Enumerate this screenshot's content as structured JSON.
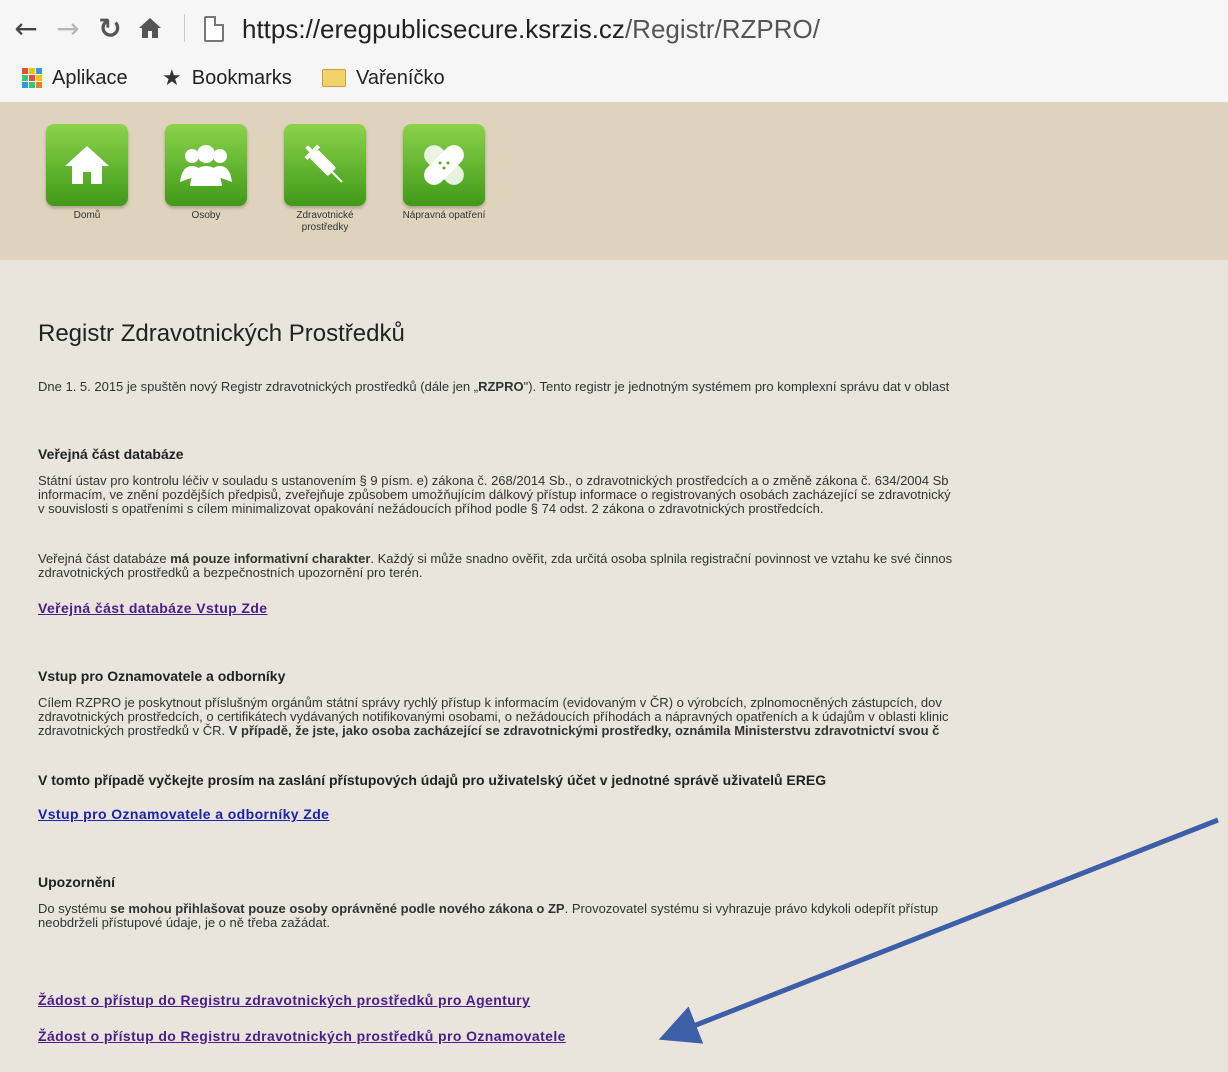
{
  "browser": {
    "url_host": "https://eregpublicsecure.ksrzis.cz",
    "url_path": "/Registr/RZPRO/",
    "bookmarks": [
      "Aplikace",
      "Bookmarks",
      "Vařeníčko"
    ]
  },
  "nav": {
    "tiles": [
      {
        "label": "Domů",
        "icon": "home-icon"
      },
      {
        "label": "Osoby",
        "icon": "people-icon"
      },
      {
        "label": "Zdravotnické prostředky",
        "icon": "syringe-icon"
      },
      {
        "label": "Nápravná opatření",
        "icon": "bandage-icon"
      }
    ]
  },
  "page": {
    "title": "Registr Zdravotnických Prostředků",
    "intro_1": "Dne 1. 5. 2015 je spuštěn nový Registr zdravotnických prostředků (dále jen „",
    "intro_bold": "RZPRO",
    "intro_2": "\"). Tento registr je jednotným systémem pro komplexní správu dat v oblast",
    "section1": {
      "heading": "Veřejná část databáze",
      "p1_line1": "Státní ústav pro kontrolu léčiv v souladu s ustanovením § 9 písm. e) zákona č. 268/2014 Sb., o zdravotnických prostředcích a o změně zákona č. 634/2004 Sb",
      "p1_line2": "informacím, ve znění pozdějších předpisů, zveřejňuje způsobem umožňujícím dálkový přístup informace o registrovaných osobách zacházející se zdravotnický",
      "p1_line3": "v souvislosti s opatřeními s cílem minimalizovat opakování nežádoucích příhod podle § 74 odst. 2 zákona o zdravotnických prostředcích.",
      "p2_a": "Veřejná část databáze ",
      "p2_bold": "má pouze informativní charakter",
      "p2_b": ". Každý si může snadno ověřit, zda určitá osoba splnila registrační povinnost ve vztahu ke své činnos",
      "p2_line2": "zdravotnických prostředků a bezpečnostních upozornění pro terén.",
      "link": "Veřejná část databáze Vstup Zde"
    },
    "section2": {
      "heading": "Vstup pro Oznamovatele a odborníky",
      "line1": "Cílem RZPRO je poskytnout příslušným orgánům státní správy rychlý přístup k informacím (evidovaným v ČR) o výrobcích, zplnomocněných zástupcích, dov",
      "line2": "zdravotnických prostředcích, o certifikátech vydávaných notifikovanými osobami, o nežádoucích příhodách a nápravných opatřeních a k údajům v oblasti klinic",
      "line3_a": "zdravotnických prostředků v ČR. ",
      "line3_bold": "V případě, že jste, jako osoba zacházející se zdravotnickými prostředky, oznámila Ministerstvu zdravotnictví svou č",
      "bold_line": "V tomto případě vyčkejte prosím na zaslání přístupových údajů pro uživatelský účet v jednotné správě uživatelů EREG",
      "link": "Vstup pro Oznamovatele a odborníky Zde"
    },
    "section3": {
      "heading": "Upozornění",
      "line1_a": "Do systému ",
      "line1_bold": "se mohou přihlašovat pouze osoby oprávněné podle nového zákona o ZP",
      "line1_b": ". Provozovatel systému si vyhrazuje právo kdykoli odepřít přístup",
      "line2": "neobdrželi přístupové údaje, je o ně třeba zažádat."
    },
    "links": [
      "Žádost o přístup do Registru zdravotnických prostředků pro Agentury",
      "Žádost o přístup do Registru zdravotnických prostředků pro Oznamovatele"
    ]
  }
}
